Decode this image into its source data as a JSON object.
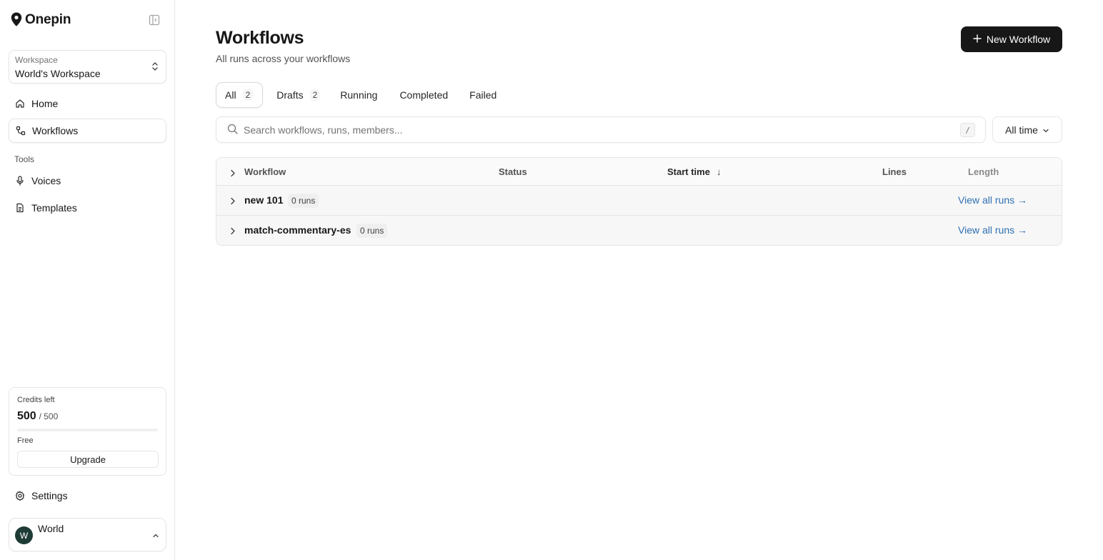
{
  "app": {
    "brand": "Onepin"
  },
  "sidebar": {
    "workspace": {
      "label": "Workspace",
      "name": "World's Workspace"
    },
    "nav": [
      {
        "label": "Home",
        "icon": "home-icon"
      },
      {
        "label": "Workflows",
        "icon": "workflow-icon",
        "active": true
      }
    ],
    "tools_label": "Tools",
    "tools": [
      {
        "label": "Voices",
        "icon": "mic-icon"
      },
      {
        "label": "Templates",
        "icon": "document-icon"
      }
    ],
    "credits": {
      "label": "Credits left",
      "remaining": "500",
      "total": "/ 500",
      "plan": "Free",
      "upgrade_label": "Upgrade"
    },
    "settings_label": "Settings",
    "user": {
      "initial": "W",
      "name": "World"
    }
  },
  "main": {
    "title": "Workflows",
    "subtitle": "All runs across your workflows",
    "new_button_label": "New Workflow",
    "tabs": [
      {
        "label": "All",
        "count": "2",
        "active": true
      },
      {
        "label": "Drafts",
        "count": "2"
      },
      {
        "label": "Running"
      },
      {
        "label": "Completed"
      },
      {
        "label": "Failed"
      }
    ],
    "search": {
      "placeholder": "Search workflows, runs, members...",
      "shortcut": "/"
    },
    "time_filter": "All time",
    "table": {
      "columns": [
        "Workflow",
        "Status",
        "Start time",
        "Lines",
        "Length"
      ],
      "sort_indicator": "↓",
      "rows": [
        {
          "name": "new 101",
          "runs": "0 runs",
          "link": "View all runs →"
        },
        {
          "name": "match-commentary-es",
          "runs": "0 runs",
          "link": "View all runs →"
        }
      ]
    }
  },
  "colors": {
    "primary": "#171717",
    "link": "#2f6fb3",
    "avatar": "#1f3b35"
  }
}
